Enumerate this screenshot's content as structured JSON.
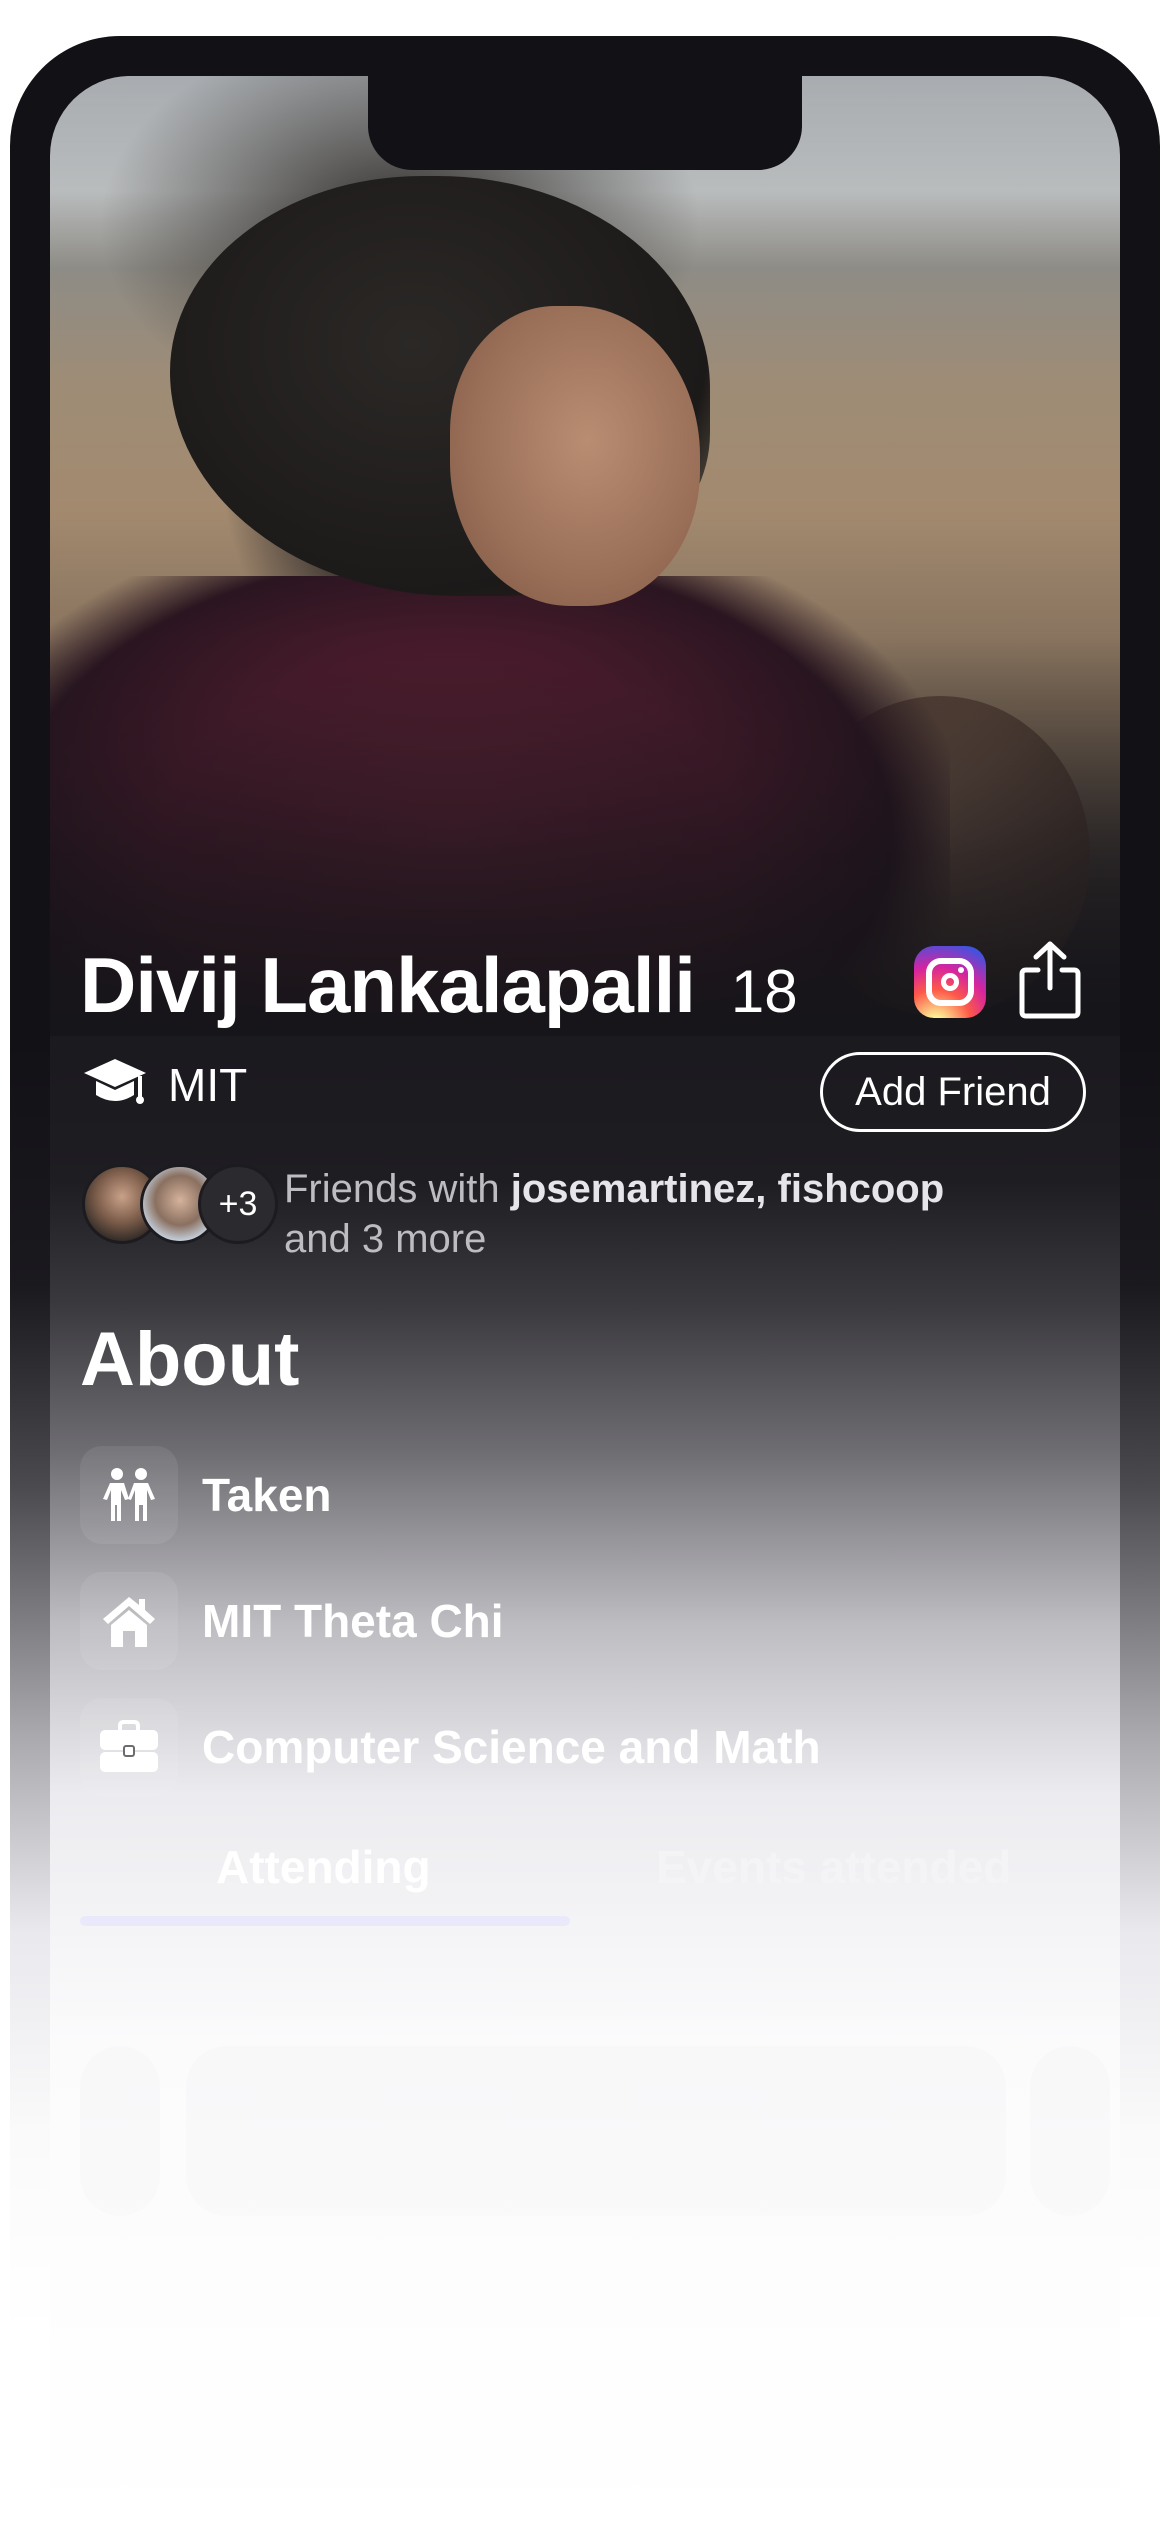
{
  "profile": {
    "name": "Divij Lankalapalli",
    "age": "18",
    "school": "MIT"
  },
  "actions": {
    "add_friend_label": "Add Friend"
  },
  "friends": {
    "more_count": "+3",
    "prefix": "Friends with ",
    "names": "josemartinez, fishcoop",
    "suffix": "and 3 more"
  },
  "about": {
    "title": "About",
    "items": [
      {
        "icon": "people-icon",
        "label": "Taken"
      },
      {
        "icon": "house-icon",
        "label": "MIT Theta Chi"
      },
      {
        "icon": "briefcase-icon",
        "label": "Computer Science and Math"
      }
    ]
  },
  "tabs": [
    {
      "label": "Attending",
      "active": true
    },
    {
      "label": "Events attended",
      "active": false
    }
  ],
  "colors": {
    "accent_underline": "#e9e9fb",
    "frame": "#121116"
  }
}
